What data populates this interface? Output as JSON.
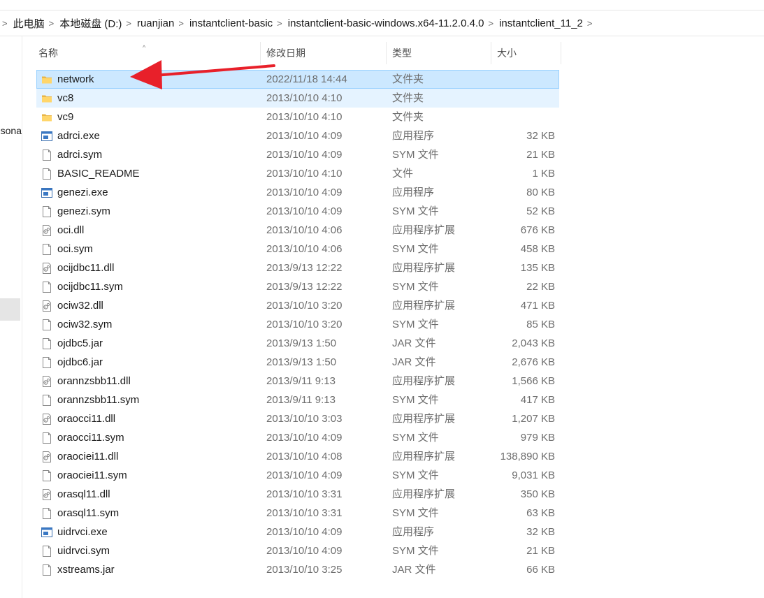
{
  "breadcrumb": [
    "此电脑",
    "本地磁盘 (D:)",
    "ruanjian",
    "instantclient-basic",
    "instantclient-basic-windows.x64-11.2.0.4.0",
    "instantclient_11_2"
  ],
  "left_pane": {
    "partial_text": "sona"
  },
  "columns": {
    "name": "名称",
    "date": "修改日期",
    "type": "类型",
    "size": "大小"
  },
  "sort": {
    "column": "name",
    "direction": "ascending"
  },
  "annotation": {
    "color": "#e8202a",
    "points_to": "network"
  },
  "files": [
    {
      "name": "network",
      "icon": "folder-icon",
      "date": "2022/11/18 14:44",
      "type": "文件夹",
      "size": "",
      "state": "selected"
    },
    {
      "name": "vc8",
      "icon": "folder-icon",
      "date": "2013/10/10 4:10",
      "type": "文件夹",
      "size": "",
      "state": "hover"
    },
    {
      "name": "vc9",
      "icon": "folder-icon",
      "date": "2013/10/10 4:10",
      "type": "文件夹",
      "size": ""
    },
    {
      "name": "adrci.exe",
      "icon": "exe-icon",
      "date": "2013/10/10 4:09",
      "type": "应用程序",
      "size": "32 KB"
    },
    {
      "name": "adrci.sym",
      "icon": "file-icon",
      "date": "2013/10/10 4:09",
      "type": "SYM 文件",
      "size": "21 KB"
    },
    {
      "name": "BASIC_README",
      "icon": "file-icon",
      "date": "2013/10/10 4:10",
      "type": "文件",
      "size": "1 KB"
    },
    {
      "name": "genezi.exe",
      "icon": "exe-icon",
      "date": "2013/10/10 4:09",
      "type": "应用程序",
      "size": "80 KB"
    },
    {
      "name": "genezi.sym",
      "icon": "file-icon",
      "date": "2013/10/10 4:09",
      "type": "SYM 文件",
      "size": "52 KB"
    },
    {
      "name": "oci.dll",
      "icon": "dll-icon",
      "date": "2013/10/10 4:06",
      "type": "应用程序扩展",
      "size": "676 KB"
    },
    {
      "name": "oci.sym",
      "icon": "file-icon",
      "date": "2013/10/10 4:06",
      "type": "SYM 文件",
      "size": "458 KB"
    },
    {
      "name": "ocijdbc11.dll",
      "icon": "dll-icon",
      "date": "2013/9/13 12:22",
      "type": "应用程序扩展",
      "size": "135 KB"
    },
    {
      "name": "ocijdbc11.sym",
      "icon": "file-icon",
      "date": "2013/9/13 12:22",
      "type": "SYM 文件",
      "size": "22 KB"
    },
    {
      "name": "ociw32.dll",
      "icon": "dll-icon",
      "date": "2013/10/10 3:20",
      "type": "应用程序扩展",
      "size": "471 KB"
    },
    {
      "name": "ociw32.sym",
      "icon": "file-icon",
      "date": "2013/10/10 3:20",
      "type": "SYM 文件",
      "size": "85 KB"
    },
    {
      "name": "ojdbc5.jar",
      "icon": "file-icon",
      "date": "2013/9/13 1:50",
      "type": "JAR 文件",
      "size": "2,043 KB"
    },
    {
      "name": "ojdbc6.jar",
      "icon": "file-icon",
      "date": "2013/9/13 1:50",
      "type": "JAR 文件",
      "size": "2,676 KB"
    },
    {
      "name": "orannzsbb11.dll",
      "icon": "dll-icon",
      "date": "2013/9/11 9:13",
      "type": "应用程序扩展",
      "size": "1,566 KB"
    },
    {
      "name": "orannzsbb11.sym",
      "icon": "file-icon",
      "date": "2013/9/11 9:13",
      "type": "SYM 文件",
      "size": "417 KB"
    },
    {
      "name": "oraocci11.dll",
      "icon": "dll-icon",
      "date": "2013/10/10 3:03",
      "type": "应用程序扩展",
      "size": "1,207 KB"
    },
    {
      "name": "oraocci11.sym",
      "icon": "file-icon",
      "date": "2013/10/10 4:09",
      "type": "SYM 文件",
      "size": "979 KB"
    },
    {
      "name": "oraociei11.dll",
      "icon": "dll-icon",
      "date": "2013/10/10 4:08",
      "type": "应用程序扩展",
      "size": "138,890 KB"
    },
    {
      "name": "oraociei11.sym",
      "icon": "file-icon",
      "date": "2013/10/10 4:09",
      "type": "SYM 文件",
      "size": "9,031 KB"
    },
    {
      "name": "orasql11.dll",
      "icon": "dll-icon",
      "date": "2013/10/10 3:31",
      "type": "应用程序扩展",
      "size": "350 KB"
    },
    {
      "name": "orasql11.sym",
      "icon": "file-icon",
      "date": "2013/10/10 3:31",
      "type": "SYM 文件",
      "size": "63 KB"
    },
    {
      "name": "uidrvci.exe",
      "icon": "exe-icon",
      "date": "2013/10/10 4:09",
      "type": "应用程序",
      "size": "32 KB"
    },
    {
      "name": "uidrvci.sym",
      "icon": "file-icon",
      "date": "2013/10/10 4:09",
      "type": "SYM 文件",
      "size": "21 KB"
    },
    {
      "name": "xstreams.jar",
      "icon": "file-icon",
      "date": "2013/10/10 3:25",
      "type": "JAR 文件",
      "size": "66 KB"
    }
  ]
}
